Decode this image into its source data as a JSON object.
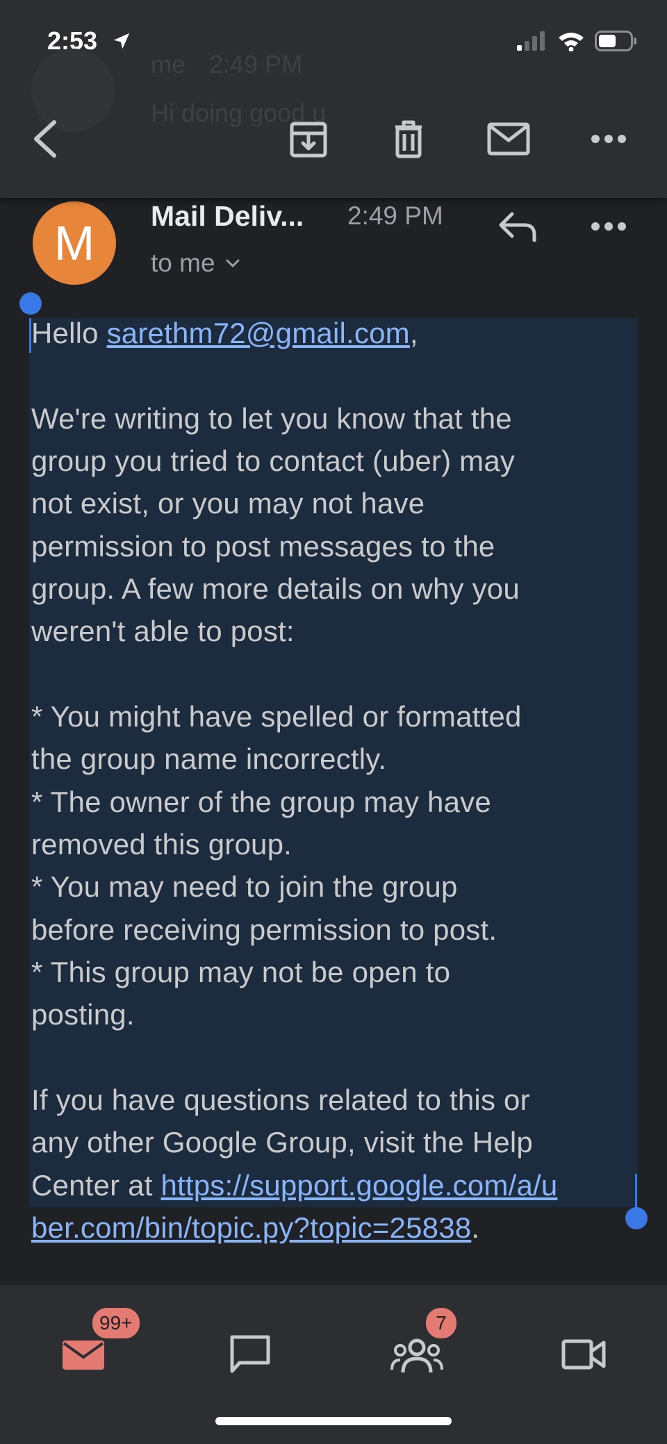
{
  "status_bar": {
    "time": "2:53"
  },
  "background_preview": {
    "sender": "me",
    "time": "2:49 PM",
    "snippet": "Hi doing good u"
  },
  "toolbar": {
    "back_icon": "arrow-left-icon",
    "archive_icon": "archive-icon",
    "delete_icon": "trash-icon",
    "mark_unread_icon": "mail-icon",
    "more_icon": "more-horizontal-icon"
  },
  "email": {
    "avatar_letter": "M",
    "avatar_color": "#e7853b",
    "sender": "Mail Deliv...",
    "time": "2:49 PM",
    "recipient": "to me",
    "body": {
      "greeting_prefix": "Hello ",
      "greeting_email": "sarethm72@gmail.com",
      "greeting_suffix": ",",
      "para1": [
        "We're writing to let you know that the",
        "group you tried to contact (uber) may",
        "not exist, or you may not have",
        "permission to post messages to the",
        "group. A few more details on why you",
        "weren't able to post:"
      ],
      "bullets": [
        " * You might have spelled or formatted",
        "the group name incorrectly.",
        " * The owner of the group may have",
        "removed this group.",
        " * You may need to join the group",
        "before receiving permission to post.",
        " * This group may not be open to",
        "posting."
      ],
      "para3": [
        "If you have questions related to this or",
        "any other Google Group, visit the Help"
      ],
      "help_prefix": "Center at ",
      "help_link_part1": "https://support.google.com/a/u",
      "help_link_part2": "ber.com/bin/topic.py?topic=25838",
      "help_suffix": "."
    }
  },
  "bottom_nav": {
    "mail_badge": "99+",
    "meet_badge": "7",
    "accent_color": "#e37b72"
  }
}
